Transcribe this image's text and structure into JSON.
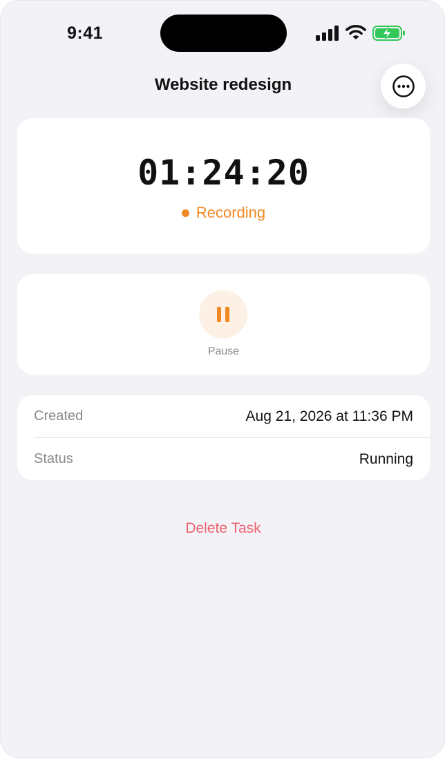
{
  "status_bar": {
    "time": "9:41",
    "icons": [
      "cellular-signal-icon",
      "wifi-icon",
      "battery-charging-icon"
    ],
    "battery_color": "#34c759"
  },
  "nav": {
    "title": "Website redesign",
    "more_icon": "ellipsis-circle-icon"
  },
  "timer": {
    "elapsed": "01:24:20",
    "state_label": "Recording",
    "state_color": "#f08a24"
  },
  "controls": {
    "pause_label": "Pause",
    "pause_icon": "pause-icon",
    "accent": "#f08a24"
  },
  "details": {
    "rows": [
      {
        "label": "Created",
        "value": "Aug 21, 2026 at 11:36 PM"
      },
      {
        "label": "Status",
        "value": "Running"
      }
    ]
  },
  "actions": {
    "delete_label": "Delete Task",
    "delete_color": "#f0626f"
  }
}
